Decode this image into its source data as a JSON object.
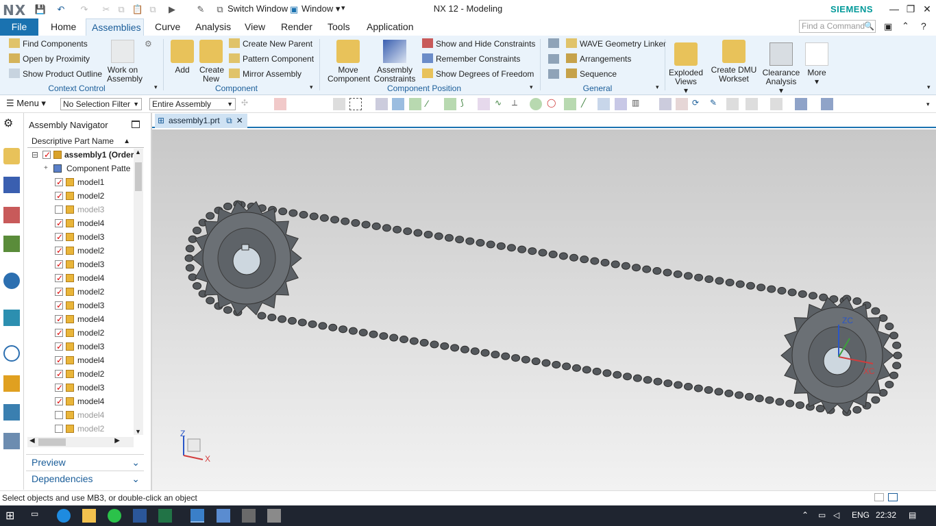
{
  "app": {
    "logo": "NX",
    "title": "NX 12 - Modeling",
    "brand": "SIEMENS",
    "quick_access": {
      "switch_window": "Switch Window",
      "window": "Window"
    }
  },
  "menu_tabs": [
    {
      "label": "File"
    },
    {
      "label": "Home"
    },
    {
      "label": "Assemblies"
    },
    {
      "label": "Curve"
    },
    {
      "label": "Analysis"
    },
    {
      "label": "View"
    },
    {
      "label": "Render"
    },
    {
      "label": "Tools"
    },
    {
      "label": "Application"
    }
  ],
  "search": {
    "placeholder": "Find a Command"
  },
  "ribbon": {
    "context_control": {
      "label": "Context Control",
      "find_components": "Find Components",
      "open_by_proximity": "Open by Proximity",
      "show_product_outline": "Show Product Outline",
      "work_on_assembly": "Work on Assembly"
    },
    "component": {
      "label": "Component",
      "add": "Add",
      "create_new": "Create New",
      "create_new_parent": "Create New Parent",
      "pattern_component": "Pattern Component",
      "mirror_assembly": "Mirror Assembly"
    },
    "component_position": {
      "label": "Component Position",
      "move_component": "Move Component",
      "assembly_constraints": "Assembly Constraints",
      "show_hide_constraints": "Show and Hide Constraints",
      "remember_constraints": "Remember Constraints",
      "show_dof": "Show Degrees of Freedom"
    },
    "general": {
      "label": "General",
      "wave_linker": "WAVE Geometry Linker",
      "arrangements": "Arrangements",
      "sequence": "Sequence"
    },
    "exploded_views": "Exploded Views",
    "create_dmu": "Create DMU Workset",
    "clearance": "Clearance Analysis",
    "more": "More"
  },
  "toolbar": {
    "menu": "Menu",
    "selection_filter": "No Selection Filter",
    "scope": "Entire Assembly"
  },
  "navigator": {
    "title": "Assembly Navigator",
    "column": "Descriptive Part Name",
    "root": "assembly1 (Order",
    "pattern": "Component Patte",
    "items": [
      {
        "name": "model1",
        "checked": true
      },
      {
        "name": "model2",
        "checked": true
      },
      {
        "name": "model3",
        "checked": false
      },
      {
        "name": "model4",
        "checked": true
      },
      {
        "name": "model3",
        "checked": true
      },
      {
        "name": "model2",
        "checked": true
      },
      {
        "name": "model3",
        "checked": true
      },
      {
        "name": "model4",
        "checked": true
      },
      {
        "name": "model2",
        "checked": true
      },
      {
        "name": "model3",
        "checked": true
      },
      {
        "name": "model4",
        "checked": true
      },
      {
        "name": "model2",
        "checked": true
      },
      {
        "name": "model3",
        "checked": true
      },
      {
        "name": "model4",
        "checked": true
      },
      {
        "name": "model2",
        "checked": true
      },
      {
        "name": "model3",
        "checked": true
      },
      {
        "name": "model4",
        "checked": true
      },
      {
        "name": "model4",
        "checked": false
      },
      {
        "name": "model2",
        "checked": false
      }
    ],
    "preview": "Preview",
    "dependencies": "Dependencies"
  },
  "document_tab": "assembly1.prt",
  "triad": {
    "z": "Z",
    "x": "X",
    "zc": "ZC",
    "xc": "XC"
  },
  "status": "Select objects and use MB3, or double-click an object",
  "taskbar": {
    "lang": "ENG",
    "time": "22:32"
  }
}
